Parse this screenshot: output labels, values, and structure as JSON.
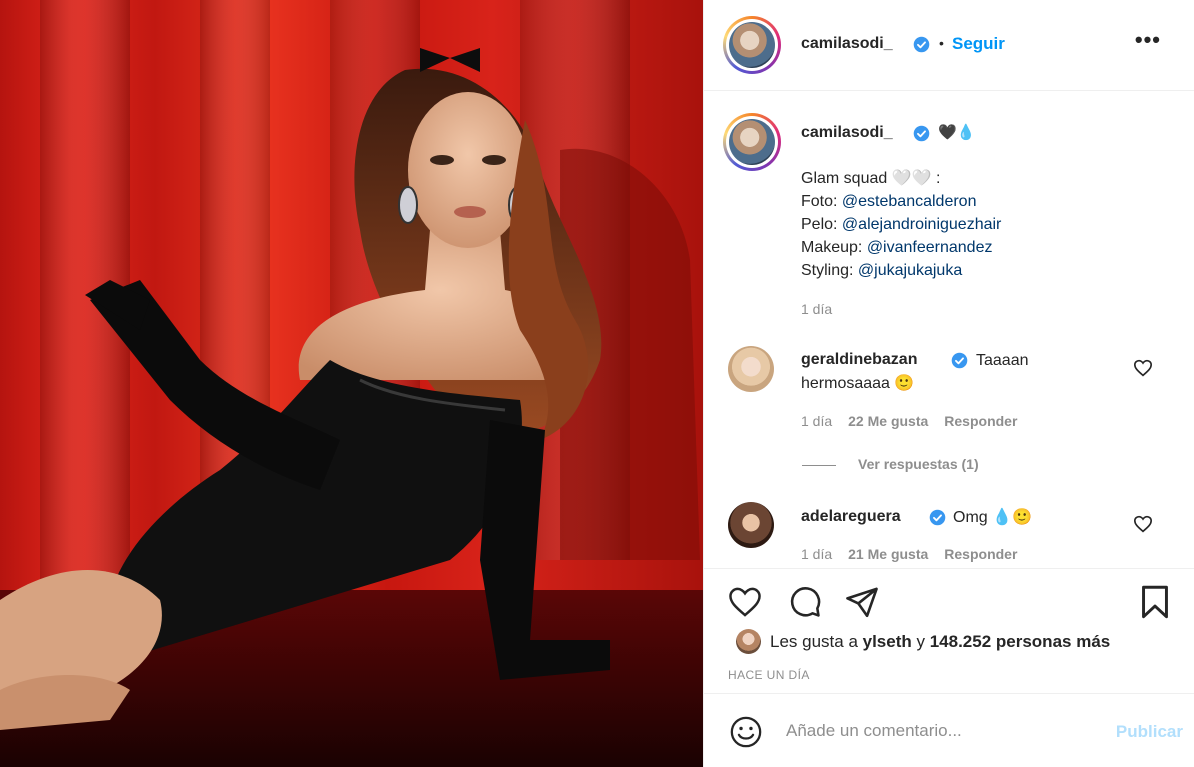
{
  "header": {
    "username": "camilasodi_",
    "separator": "•",
    "follow_label": "Seguir",
    "more_label": "•••"
  },
  "caption": {
    "username": "camilasodi_",
    "emoji": "🖤💧",
    "line1": "Glam squad 🤍🤍 :",
    "foto_label": "Foto: ",
    "foto_handle": "@estebancalderon",
    "pelo_label": "Pelo: ",
    "pelo_handle": "@alejandroiniguezhair",
    "makeup_label": "Makeup: ",
    "makeup_handle": "@ivanfeernandez",
    "styling_label": "Styling: ",
    "styling_handle": "@jukajukajuka",
    "time": "1 día"
  },
  "comments": [
    {
      "username": "geraldinebazan",
      "text_line1": "Taaaan",
      "text_line2": "hermosaaaa 🙂",
      "time": "1 día",
      "likes": "22 Me gusta",
      "reply": "Responder",
      "view_replies": "Ver respuestas (1)"
    },
    {
      "username": "adelareguera",
      "text": "Omg 💧🙂",
      "time": "1 día",
      "likes": "21 Me gusta",
      "reply": "Responder"
    }
  ],
  "likes": {
    "prefix": "Les gusta a ",
    "user": "ylseth",
    "middle": " y ",
    "count": "148.252 personas más"
  },
  "posted_ago": "HACE UN DÍA",
  "comment_box": {
    "placeholder": "Añade un comentario...",
    "publish_label": "Publicar"
  },
  "colors": {
    "accent": "#0095f6",
    "verified": "#3897f0",
    "muted": "#8e8e8e",
    "publish_disabled": "#b2dffc",
    "photo_background": "#d8231a"
  }
}
